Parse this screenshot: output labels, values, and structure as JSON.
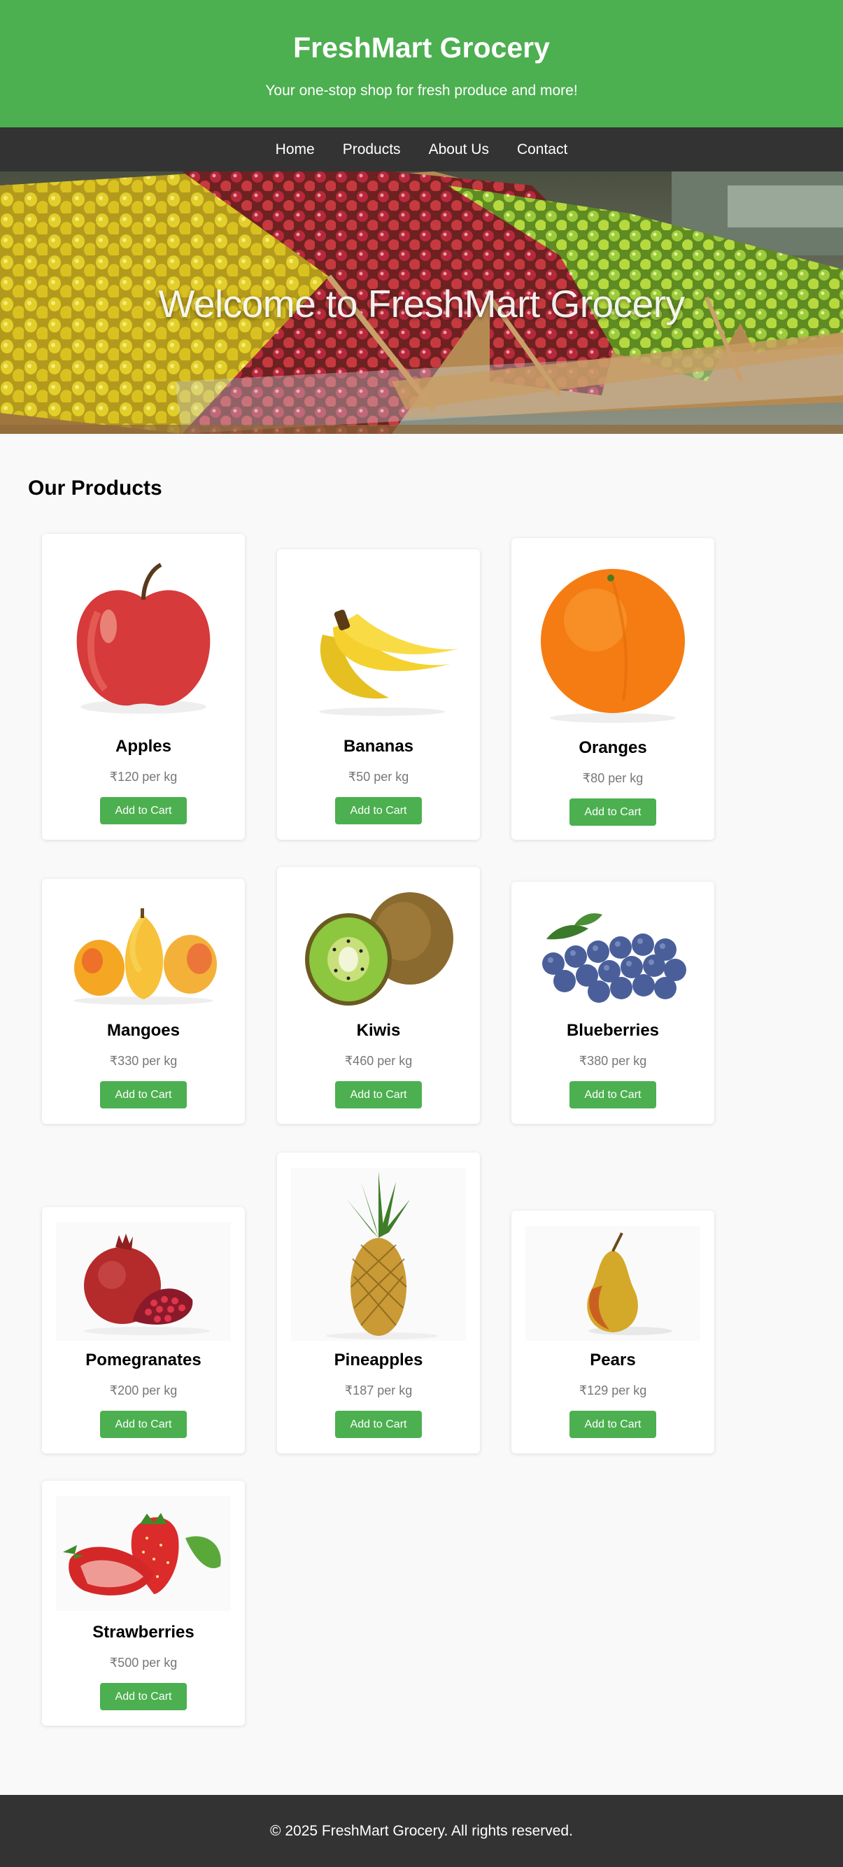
{
  "header": {
    "title": "FreshMart Grocery",
    "tagline": "Your one-stop shop for fresh produce and more!"
  },
  "nav": {
    "items": [
      "Home",
      "Products",
      "About Us",
      "Contact"
    ]
  },
  "hero": {
    "title": "Welcome to FreshMart Grocery"
  },
  "products_section": {
    "title": "Our Products",
    "button_label": "Add to Cart",
    "items": [
      {
        "name": "Apples",
        "price": "₹120 per kg"
      },
      {
        "name": "Bananas",
        "price": "₹50 per kg"
      },
      {
        "name": "Oranges",
        "price": "₹80 per kg"
      },
      {
        "name": "Mangoes",
        "price": "₹330 per kg"
      },
      {
        "name": "Kiwis",
        "price": "₹460 per kg"
      },
      {
        "name": "Blueberries",
        "price": "₹380 per kg"
      },
      {
        "name": "Pomegranates",
        "price": "₹200 per kg"
      },
      {
        "name": "Pineapples",
        "price": "₹187 per kg"
      },
      {
        "name": "Pears",
        "price": "₹129 per kg"
      },
      {
        "name": "Strawberries",
        "price": "₹500 per kg"
      }
    ]
  },
  "footer": {
    "text": "© 2025 FreshMart Grocery. All rights reserved."
  },
  "colors": {
    "brand_green": "#4caf50",
    "nav_dark": "#333333",
    "page_bg": "#f9f9f9",
    "price_gray": "#777777"
  }
}
